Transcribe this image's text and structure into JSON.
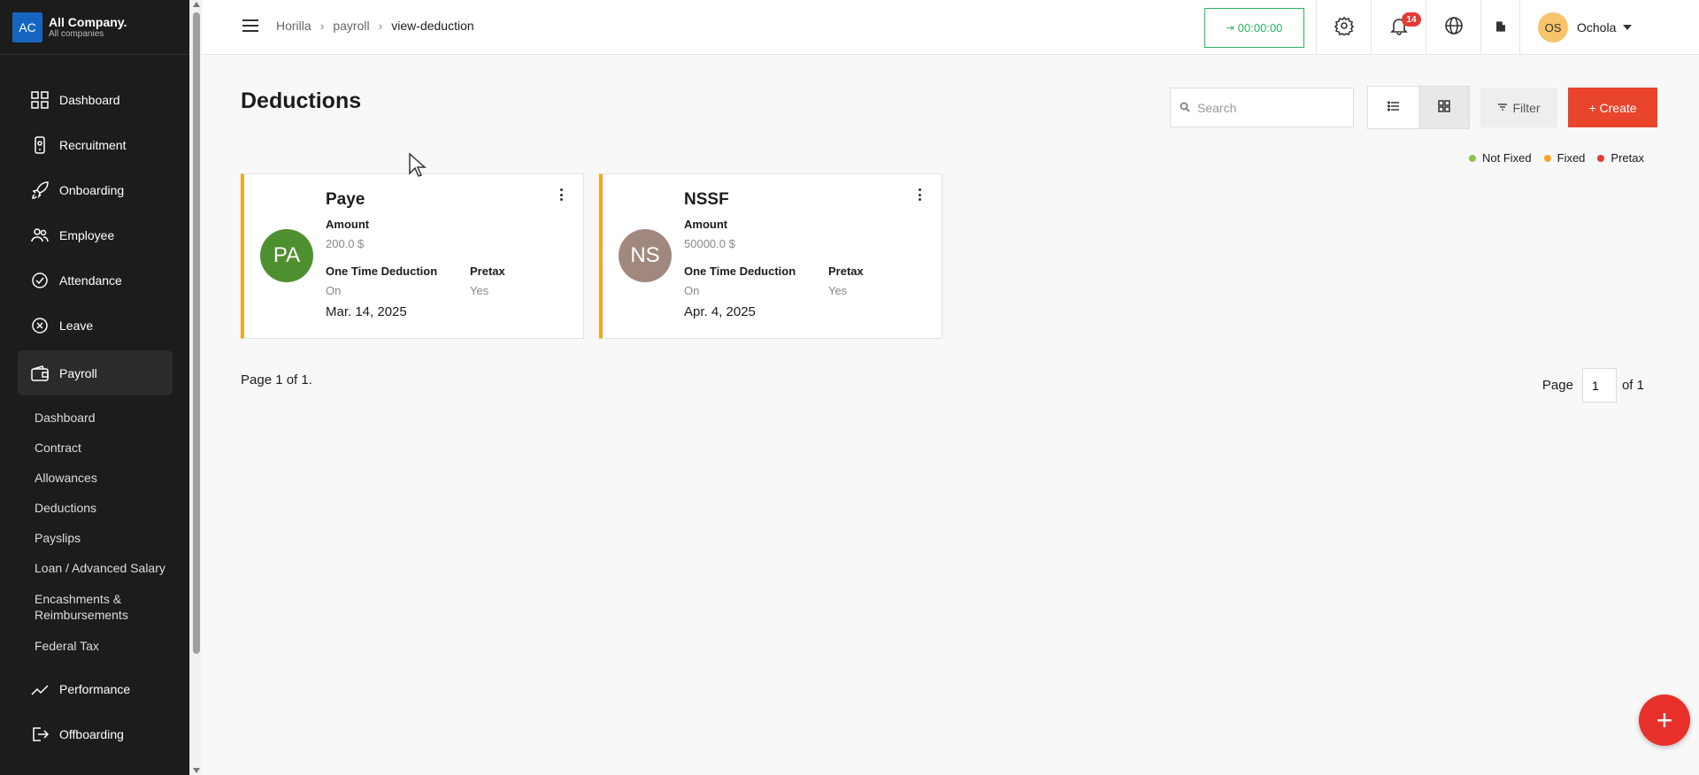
{
  "company": {
    "logo_text": "AC",
    "name": "All Company.",
    "subtitle": "All companies"
  },
  "sidebar": {
    "items": [
      {
        "label": "Dashboard",
        "icon": "grid-icon"
      },
      {
        "label": "Recruitment",
        "icon": "phone-icon"
      },
      {
        "label": "Onboarding",
        "icon": "rocket-icon"
      },
      {
        "label": "Employee",
        "icon": "people-icon"
      },
      {
        "label": "Attendance",
        "icon": "check-circle-icon"
      },
      {
        "label": "Leave",
        "icon": "x-circle-icon"
      },
      {
        "label": "Payroll",
        "icon": "wallet-icon",
        "active": true
      },
      {
        "label": "Performance",
        "icon": "trend-icon"
      },
      {
        "label": "Offboarding",
        "icon": "exit-icon"
      }
    ],
    "payroll_sub": [
      "Dashboard",
      "Contract",
      "Allowances",
      "Deductions",
      "Payslips",
      "Loan / Advanced Salary",
      "Encashments & Reimbursements",
      "Federal Tax"
    ]
  },
  "topbar": {
    "breadcrumb": [
      "Horilla",
      "payroll",
      "view-deduction"
    ],
    "timer": "00:00:00",
    "notification_count": "14",
    "user_initials": "OS",
    "user_name": "Ochola"
  },
  "main": {
    "title": "Deductions",
    "search_placeholder": "Search",
    "filter_label": "Filter",
    "create_label": "+ Create",
    "legend": [
      {
        "label": "Not Fixed",
        "color": "#8bc34a"
      },
      {
        "label": "Fixed",
        "color": "#f5a623"
      },
      {
        "label": "Pretax",
        "color": "#e53935"
      }
    ],
    "cards": [
      {
        "initials": "PA",
        "avatar_color": "#4e8f2f",
        "name": "Paye",
        "amount_label": "Amount",
        "amount": "200.0 $",
        "one_time_label": "One Time Deduction",
        "one_time": "On",
        "pretax_label": "Pretax",
        "pretax": "Yes",
        "date": "Mar. 14, 2025"
      },
      {
        "initials": "NS",
        "avatar_color": "#a1887f",
        "name": "NSSF",
        "amount_label": "Amount",
        "amount": "50000.0 $",
        "one_time_label": "One Time Deduction",
        "one_time": "On",
        "pretax_label": "Pretax",
        "pretax": "Yes",
        "date": "Apr. 4, 2025"
      }
    ],
    "page_info": "Page 1 of 1.",
    "pager_label": "Page",
    "pager_value": "1",
    "pager_total": "of 1",
    "fab": "+"
  }
}
